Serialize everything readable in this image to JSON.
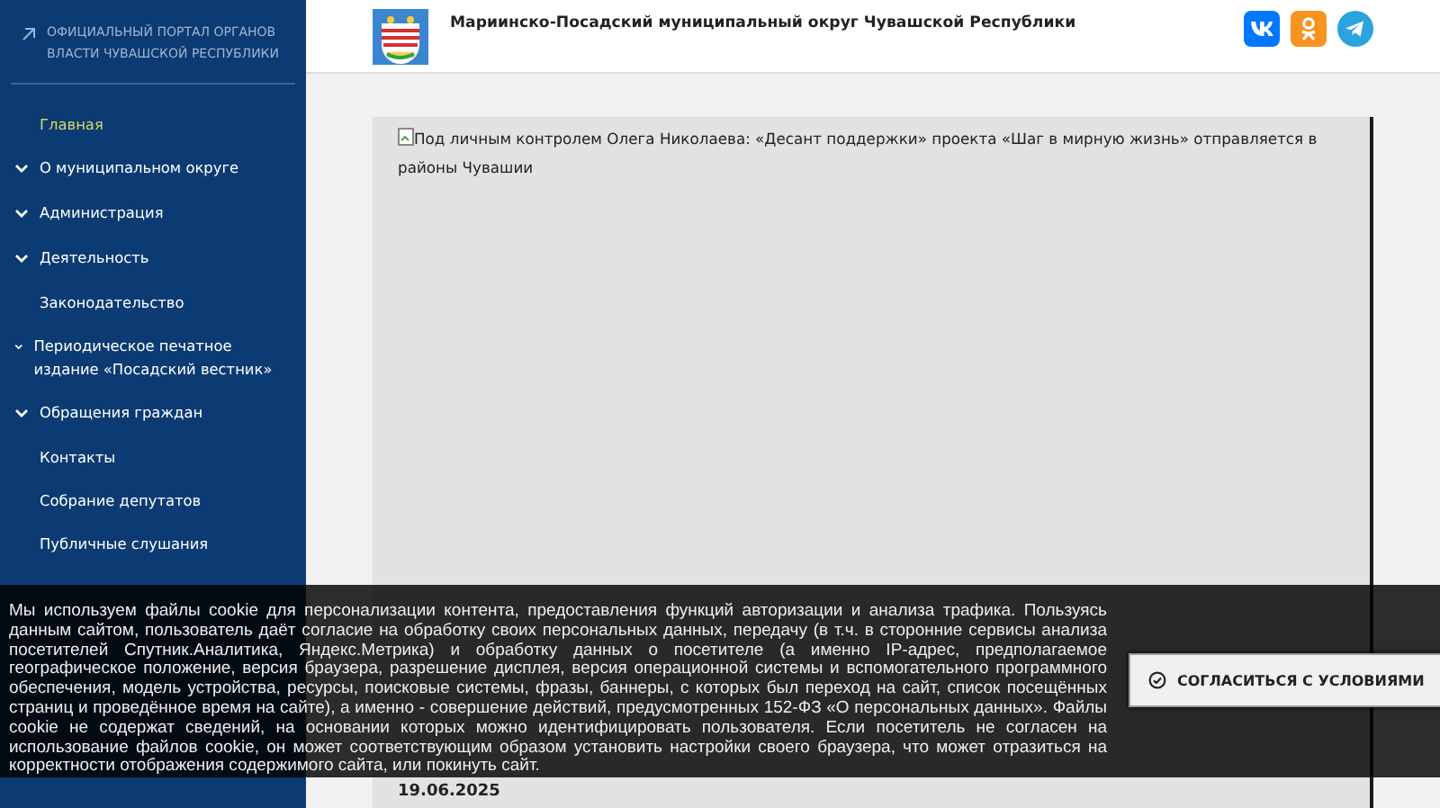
{
  "sidebar": {
    "portal_link": "ОФИЦИАЛЬНЫЙ ПОРТАЛ ОРГАНОВ ВЛАСТИ ЧУВАШСКОЙ РЕСПУБЛИКИ",
    "items": [
      {
        "label": "Главная",
        "kind": "link",
        "selected": true
      },
      {
        "label": "О муниципальном округе",
        "kind": "submenu",
        "selected": false
      },
      {
        "label": "Администрация",
        "kind": "submenu",
        "selected": false
      },
      {
        "label": "Деятельность",
        "kind": "submenu",
        "selected": false
      },
      {
        "label": "Законодательство",
        "kind": "link",
        "selected": false
      },
      {
        "label": "Периодическое печатное издание «Посадский вестник»",
        "kind": "submenu",
        "selected": false
      },
      {
        "label": "Обращения граждан",
        "kind": "submenu",
        "selected": false
      },
      {
        "label": "Контакты",
        "kind": "link",
        "selected": false
      },
      {
        "label": "Собрание депутатов",
        "kind": "link",
        "selected": false
      },
      {
        "label": "Публичные слушания",
        "kind": "link",
        "selected": false
      }
    ]
  },
  "header": {
    "title": "Мариинско-Посадский муниципальный округ Чувашской Республики"
  },
  "news": {
    "image_alt": "Под личным контролем Олега Николаева: «Десант поддержки» проекта «Шаг в мирную жизнь» отправляется в районы Чувашии",
    "date": "19.06.2025"
  },
  "cookie_banner": {
    "text": "Мы используем файлы cookie для персонализации контента, предоставления функций авторизации и анализа трафика. Пользуясь данным сайтом, пользователь даёт согласие на обработку своих персональных данных, передачу (в т.ч. в сторонние сервисы анализа посетителей Спутник.Аналитика, Яндекс.Метрика) и обработку данных о посетителе (а именно IP-адрес, предполагаемое географическое положение, версия браузера, разрешение дисплея, версия операционной системы и вспомогательного программного обеспечения, модель устройства, ресурсы, поисковые системы, фразы, баннеры, с которых был переход на сайт, список посещённых страниц и проведённое время на сайте), а именно - совершение действий, предусмотренных 152-ФЗ «О персональных данных». Файлы cookie не содержат сведений, на основании которых можно идентифицировать пользователя. Если посетитель не согласен на использование файлов cookie, он может соответствующим образом установить настройки своего браузера, что может отразиться на корректности отображения содержимого сайта, или покинуть сайт.",
    "button": "СОГЛАСИТЬСЯ С УСЛОВИЯМИ"
  }
}
